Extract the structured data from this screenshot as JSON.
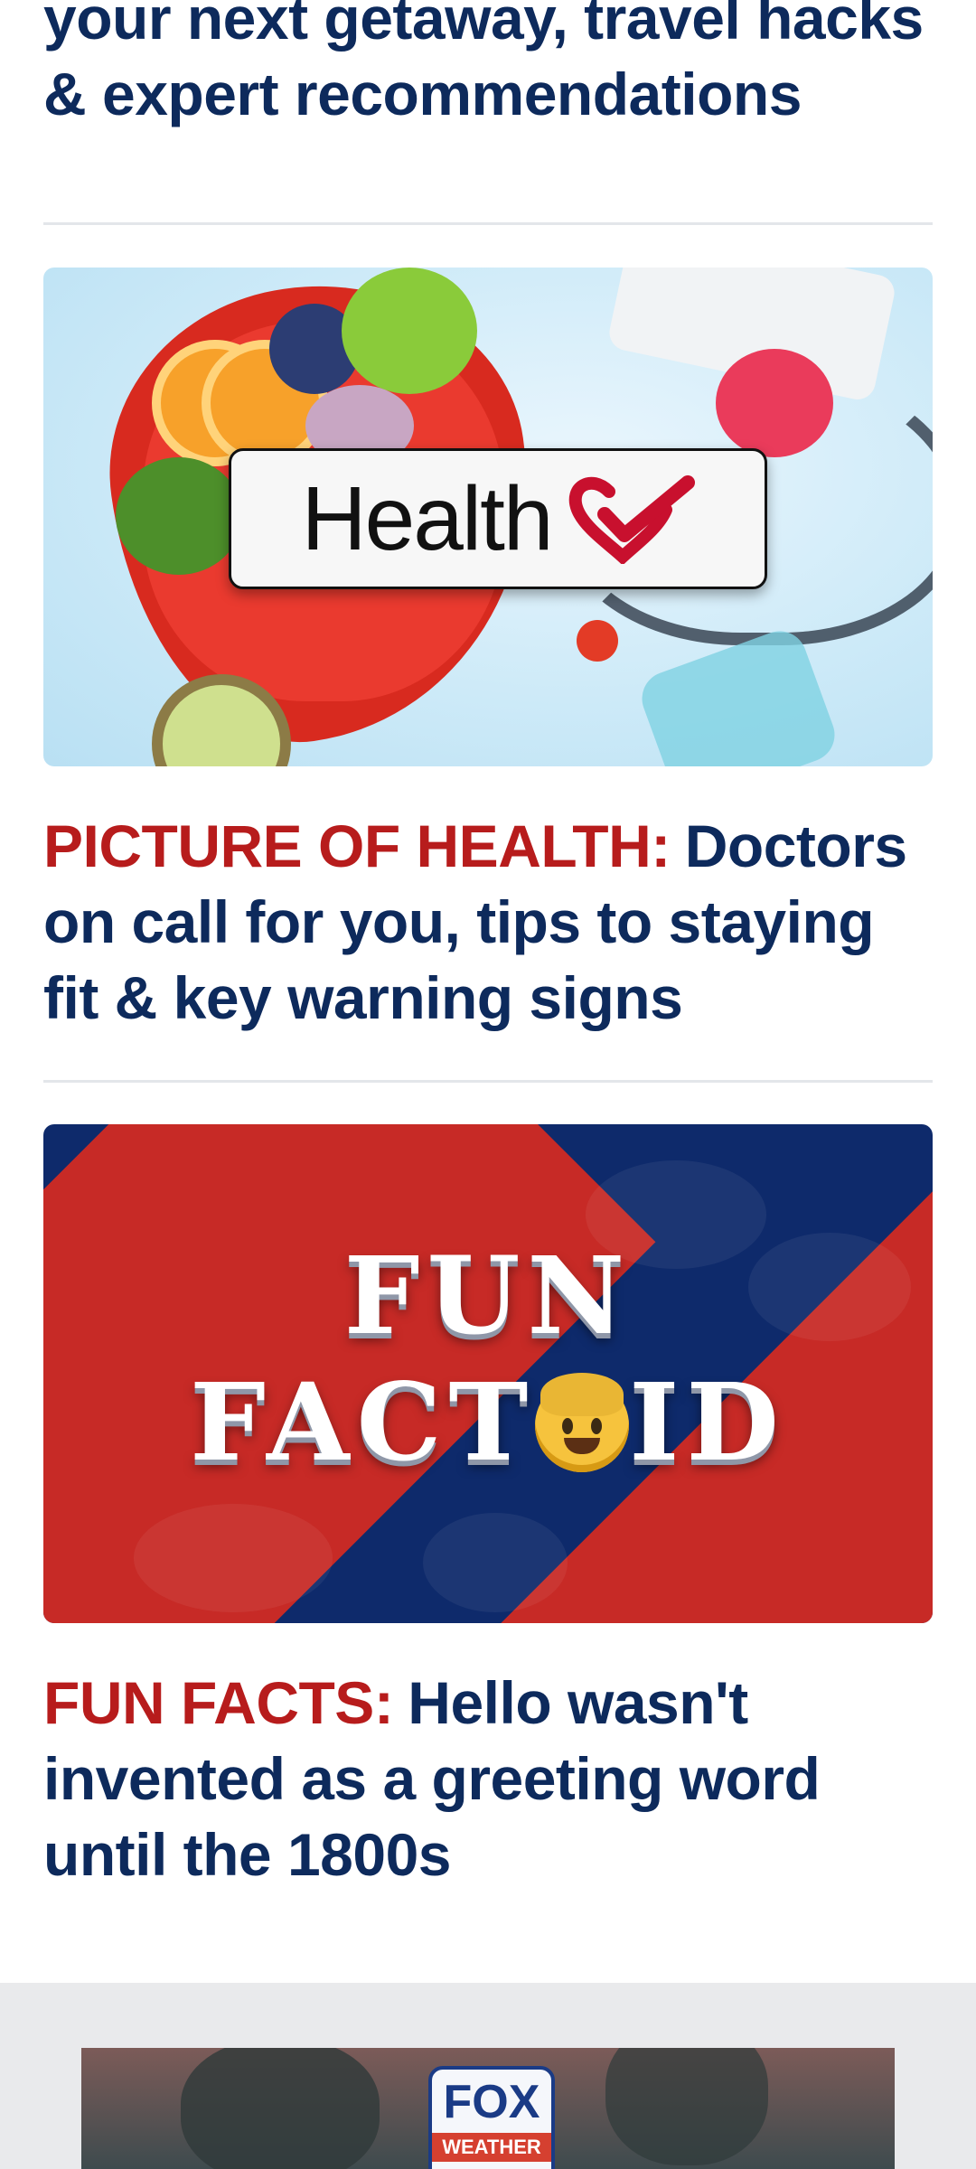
{
  "articles": [
    {
      "headline_tail": "your next getaway, travel hacks & expert recommendations"
    },
    {
      "image_logo_text": "Health",
      "kicker": "PICTURE OF HEALTH:",
      "headline": "Doctors on call for you, tips to staying fit & key warning signs"
    },
    {
      "image_title_line1": "FUN",
      "image_title_line2_left": "FACT",
      "image_title_line2_right": "ID",
      "kicker": "FUN FACTS:",
      "headline": "Hello wasn't invented as a greeting word until the 1800s"
    }
  ],
  "ad": {
    "brand_top": "FOX",
    "brand_bottom": "WEATHER"
  },
  "colors": {
    "headline": "#0d2a5c",
    "kicker": "#b71c1c",
    "divider": "#e3e6ea",
    "panel": "#e9eaec"
  }
}
